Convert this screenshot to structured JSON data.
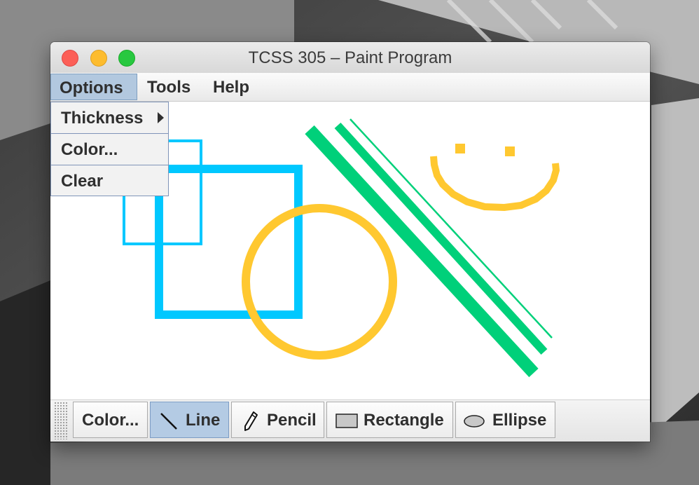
{
  "window": {
    "title": "TCSS 305 – Paint Program"
  },
  "menubar": {
    "items": [
      {
        "label": "Options",
        "active": true
      },
      {
        "label": "Tools"
      },
      {
        "label": "Help"
      }
    ]
  },
  "options_menu": {
    "items": [
      {
        "label": "Thickness",
        "has_submenu": true
      },
      {
        "label": "Color..."
      },
      {
        "label": "Clear"
      }
    ]
  },
  "toolbar": {
    "buttons": [
      {
        "label": "Color...",
        "icon": null
      },
      {
        "label": "Line",
        "icon": "line-icon",
        "selected": true
      },
      {
        "label": "Pencil",
        "icon": "pencil-icon"
      },
      {
        "label": "Rectangle",
        "icon": "rectangle-icon"
      },
      {
        "label": "Ellipse",
        "icon": "ellipse-icon"
      }
    ]
  },
  "drawing": {
    "colors": {
      "blue": "#00c8ff",
      "yellow": "#ffc830",
      "green": "#00d07a"
    },
    "shapes": [
      "thin blue rectangle",
      "thick blue rectangle",
      "yellow circle",
      "three green diagonal lines",
      "yellow pencil smiley"
    ]
  }
}
